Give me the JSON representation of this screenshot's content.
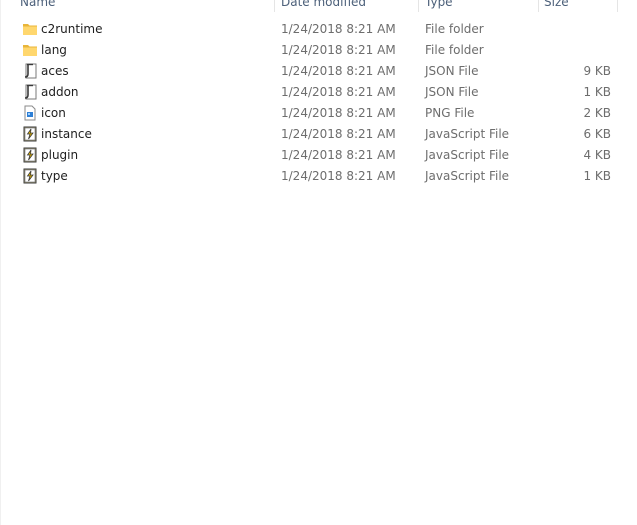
{
  "columns": {
    "name": "Name",
    "date": "Date modified",
    "type": "Type",
    "size": "Size"
  },
  "files": [
    {
      "name": "c2runtime",
      "date": "1/24/2018 8:21 AM",
      "type": "File folder",
      "size": "",
      "icon": "folder-icon"
    },
    {
      "name": "lang",
      "date": "1/24/2018 8:21 AM",
      "type": "File folder",
      "size": "",
      "icon": "folder-icon"
    },
    {
      "name": "aces",
      "date": "1/24/2018 8:21 AM",
      "type": "JSON File",
      "size": "9 KB",
      "icon": "json-file-icon"
    },
    {
      "name": "addon",
      "date": "1/24/2018 8:21 AM",
      "type": "JSON File",
      "size": "1 KB",
      "icon": "json-file-icon"
    },
    {
      "name": "icon",
      "date": "1/24/2018 8:21 AM",
      "type": "PNG File",
      "size": "2 KB",
      "icon": "png-file-icon"
    },
    {
      "name": "instance",
      "date": "1/24/2018 8:21 AM",
      "type": "JavaScript File",
      "size": "6 KB",
      "icon": "javascript-file-icon"
    },
    {
      "name": "plugin",
      "date": "1/24/2018 8:21 AM",
      "type": "JavaScript File",
      "size": "4 KB",
      "icon": "javascript-file-icon"
    },
    {
      "name": "type",
      "date": "1/24/2018 8:21 AM",
      "type": "JavaScript File",
      "size": "1 KB",
      "icon": "javascript-file-icon"
    }
  ]
}
